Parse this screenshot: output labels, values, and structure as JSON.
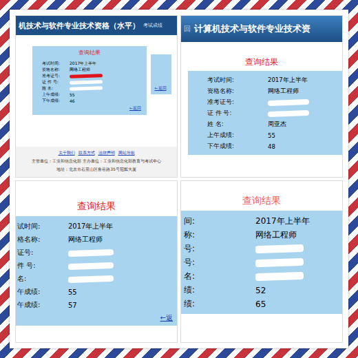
{
  "panels": [
    {
      "kind": "full",
      "header": {
        "title": "机技术与软件专业技术资格（水平）",
        "subtitle": "考试成绩",
        "back_mark": ""
      },
      "result_title": "查询结果",
      "rows": [
        {
          "label": "考试时间:",
          "value": "2017年上半年",
          "redacted": false,
          "color": "#000000"
        },
        {
          "label": "资格名称:",
          "value": "网络工程师",
          "redacted": false,
          "color": "#000000"
        },
        {
          "label": "准考证号:",
          "value": "",
          "redacted": true,
          "color": "#e0141e"
        },
        {
          "label": "证 件 号:",
          "value": "",
          "redacted": true,
          "color": "#ffffff"
        },
        {
          "label": "姓 名:",
          "value": "",
          "redacted": true,
          "color": "#ffffff"
        },
        {
          "label": "上午成绩:",
          "value": "55",
          "redacted": false,
          "color": "#000000"
        },
        {
          "label": "下午成绩:",
          "value": "46",
          "redacted": false,
          "color": "#000000"
        }
      ],
      "back_link": "←返回",
      "side_back_link": "←返回",
      "footer": {
        "links": [
          "关于我们",
          "联系方式",
          "法律声明",
          "网站导航"
        ],
        "lines": [
          "主管单位：工业和信息化部 主办单位：工业和信息化部教育与考试中心",
          "地址：北京市石景山区鲁谷路35号冠辉大厦"
        ]
      }
    },
    {
      "kind": "header-zoom",
      "header": {
        "title": "计算机技术与软件专业技术资",
        "subtitle": "",
        "back_mark": "回"
      },
      "result_title": "查询结果",
      "rows": [
        {
          "label": "考试时间:",
          "value": "2017年上半年",
          "redacted": false,
          "color": "#000000"
        },
        {
          "label": "资格名称:",
          "value": "网络工程师",
          "redacted": false,
          "color": "#000000"
        },
        {
          "label": "准考证号:",
          "value": "",
          "redacted": true,
          "color": "#ffffff"
        },
        {
          "label": "证 件 号:",
          "value": "",
          "redacted": true,
          "color": "#ffffff"
        },
        {
          "label": "姓 名:",
          "value": "周亚杰",
          "redacted": false,
          "color": "#000000"
        },
        {
          "label": "上午成绩:",
          "value": "55",
          "redacted": false,
          "color": "#000000"
        },
        {
          "label": "下午成绩:",
          "value": "48",
          "redacted": false,
          "color": "#000000"
        }
      ],
      "back_link": "",
      "side_back_link": "",
      "footer": {
        "links": [],
        "lines": []
      }
    },
    {
      "kind": "crop",
      "header": {
        "title": "",
        "subtitle": "",
        "back_mark": ""
      },
      "result_title": "查询结果",
      "rows": [
        {
          "label": "试时间:",
          "value": "2017年上半年",
          "redacted": false,
          "color": "#000000"
        },
        {
          "label": "格名称:",
          "value": "网络工程师",
          "redacted": false,
          "color": "#000000"
        },
        {
          "label": "证号:",
          "value": "",
          "redacted": true,
          "color": "#ffffff"
        },
        {
          "label": "件 号:",
          "value": "",
          "redacted": true,
          "color": "#ffffff"
        },
        {
          "label": "名:",
          "value": "",
          "redacted": true,
          "color": "#ffffff"
        },
        {
          "label": "午成绩:",
          "value": "55",
          "redacted": false,
          "color": "#000000"
        },
        {
          "label": "午成绩:",
          "value": "57",
          "redacted": false,
          "color": "#000000"
        }
      ],
      "back_link": "←返",
      "side_back_link": "",
      "footer": {
        "links": [],
        "lines": []
      }
    },
    {
      "kind": "crop-zoom",
      "header": {
        "title": "",
        "subtitle": "",
        "back_mark": ""
      },
      "result_title": "查询结果",
      "rows": [
        {
          "label": "间:",
          "value": "2017年上半年",
          "redacted": false,
          "color": "#000000"
        },
        {
          "label": "称:",
          "value": "网络工程师",
          "redacted": false,
          "color": "#000000"
        },
        {
          "label": "号:",
          "value": "",
          "redacted": true,
          "color": "#ffffff"
        },
        {
          "label": "号:",
          "value": "",
          "redacted": true,
          "color": "#ffffff"
        },
        {
          "label": "名:",
          "value": "",
          "redacted": true,
          "color": "#ffffff"
        },
        {
          "label": "绩:",
          "value": "52",
          "redacted": false,
          "color": "#000000"
        },
        {
          "label": "绩:",
          "value": "65",
          "redacted": false,
          "color": "#000000"
        }
      ],
      "back_link": "",
      "side_back_link": "",
      "footer": {
        "links": [],
        "lines": []
      }
    }
  ]
}
